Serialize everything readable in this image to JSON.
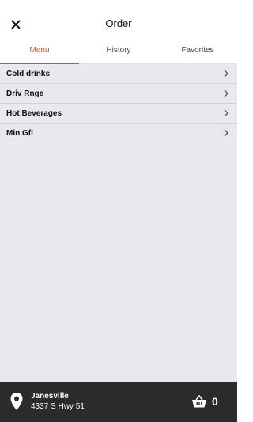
{
  "header": {
    "title": "Order",
    "close_icon": "close-icon"
  },
  "tabs": [
    {
      "label": "Menu",
      "active": true
    },
    {
      "label": "History",
      "active": false
    },
    {
      "label": "Favorites",
      "active": false
    }
  ],
  "menu": {
    "items": [
      {
        "label": "Cold drinks"
      },
      {
        "label": "Driv Rnge"
      },
      {
        "label": "Hot Beverages"
      },
      {
        "label": "Min.Gfl"
      }
    ]
  },
  "footer": {
    "store_name": "Janesville",
    "store_address": "4337 S Hwy 51",
    "cart_count": "0"
  },
  "colors": {
    "accent": "#c8582c",
    "content_bg": "#e9e8ee",
    "footer_bg": "#2b2b2b"
  }
}
